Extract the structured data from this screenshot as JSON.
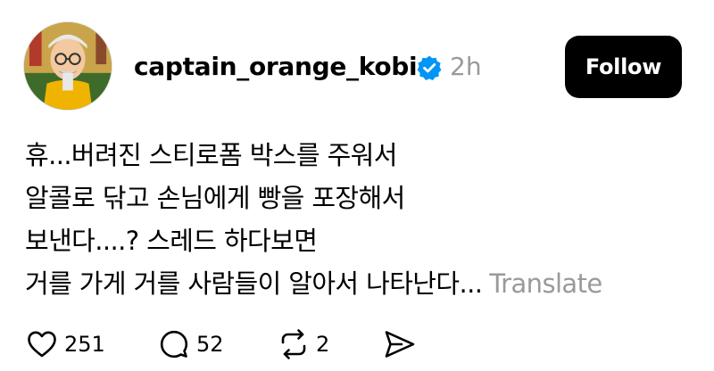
{
  "post": {
    "username": "captain_orange_kobi",
    "time": "2h",
    "follow_label": "Follow",
    "text_lines": [
      "휴...버려진 스티로폼 박스를 주워서",
      "알콜로 닦고 손님에게 빵을 포장해서",
      "보낸다....? 스레드 하다보면",
      "거를 가게 거를 사람들이 알아서 나타난다..."
    ],
    "translate_label": "Translate",
    "actions": {
      "likes": "251",
      "replies": "52",
      "reposts": "2"
    }
  },
  "icons": {
    "avatar": "cartoon-avatar",
    "verified": "verified-badge-icon",
    "like": "heart-icon",
    "reply": "comment-icon",
    "repost": "repost-icon",
    "share": "send-icon"
  },
  "colors": {
    "verified_blue": "#0095f6",
    "muted_text": "#9a9a9a",
    "button_bg": "#000000"
  }
}
